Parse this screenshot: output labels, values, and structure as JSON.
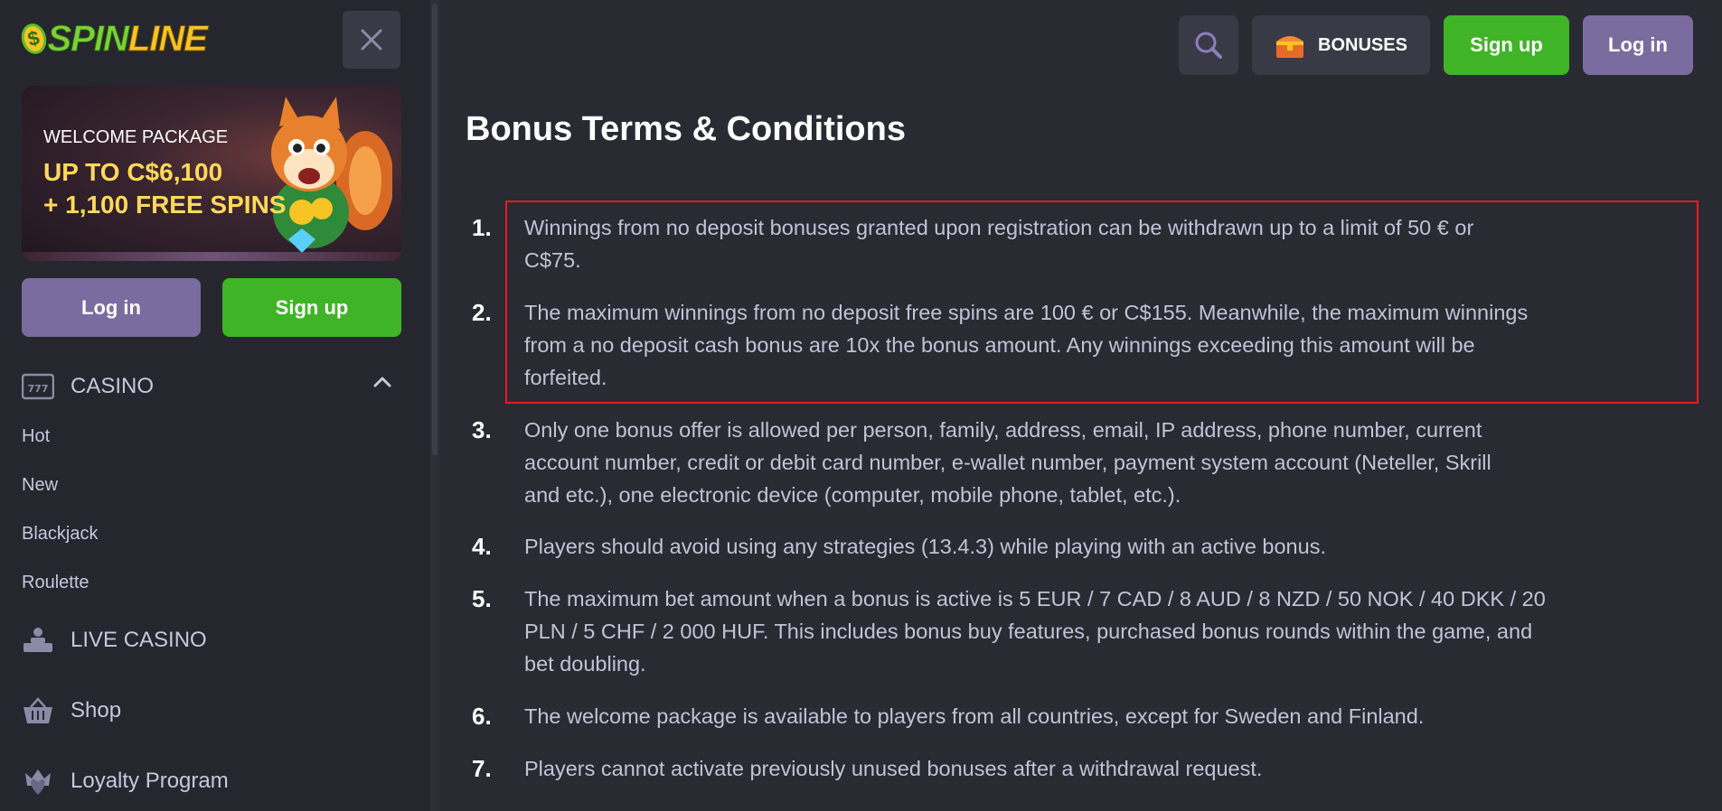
{
  "brand": {
    "logo_spin": "SPIN",
    "logo_line": "LINE",
    "logo_coin": "$"
  },
  "sidebar": {
    "banner": {
      "welcome": "WELCOME PACKAGE",
      "offer_line1": "UP TO C$6,100",
      "offer_line2": "+ 1,100 FREE SPINS"
    },
    "login_label": "Log in",
    "signup_label": "Sign up",
    "casino_label": "CASINO",
    "casino_items": [
      "Hot",
      "New",
      "Blackjack",
      "Roulette"
    ],
    "live_casino_label": "LIVE CASINO",
    "shop_label": "Shop",
    "loyalty_label": "Loyalty Program",
    "casino_icon_text": "777"
  },
  "header": {
    "bonuses_label": "BONUSES",
    "signup_label": "Sign up",
    "login_label": "Log in"
  },
  "main": {
    "title": "Bonus Terms & Conditions",
    "terms": [
      {
        "num": "1.",
        "lines": [
          "Winnings from no deposit bonuses granted upon registration can be withdrawn up to a limit of 50 € or",
          "C$75."
        ]
      },
      {
        "num": "2.",
        "lines": [
          "The maximum winnings from no deposit free spins are 100 € or C$155. Meanwhile, the maximum winnings",
          "from a no deposit cash bonus are 10x the bonus amount. Any winnings exceeding this amount will be",
          "forfeited."
        ]
      },
      {
        "num": "3.",
        "lines": [
          "Only one bonus offer is allowed per person, family, address, email, IP address, phone number, current",
          "account number, credit or debit card number, e-wallet number, payment system account (Neteller, Skrill",
          "and etc.), one electronic device (computer, mobile phone, tablet, etc.)."
        ]
      },
      {
        "num": "4.",
        "lines": [
          "Players should avoid using any strategies (13.4.3) while playing with an active bonus."
        ]
      },
      {
        "num": "5.",
        "lines": [
          "The maximum bet amount when a bonus is active is 5 EUR / 7 CAD / 8 AUD / 8 NZD / 50 NOK / 40 DKK / 20",
          "PLN / 5 CHF / 2 000 HUF. This includes bonus buy features, purchased bonus rounds within the game, and",
          "bet doubling."
        ]
      },
      {
        "num": "6.",
        "lines": [
          "The welcome package is available to players from all countries, except for Sweden and Finland."
        ]
      },
      {
        "num": "7.",
        "lines": [
          "Players cannot activate previously unused bonuses after a withdrawal request."
        ]
      }
    ]
  },
  "colors": {
    "accent_green": "#3fb427",
    "accent_purple": "#7a6c9f",
    "highlight_red": "#e31b23",
    "background": "#2a2a33"
  }
}
